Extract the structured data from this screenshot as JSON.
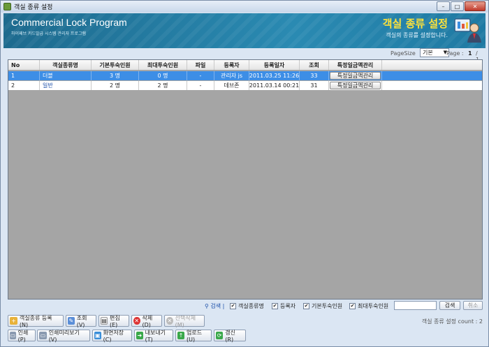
{
  "window": {
    "title": "객실 종류 설정",
    "btn_min": "–",
    "btn_max": "□",
    "btn_close": "✕"
  },
  "banner": {
    "title": "Commercial Lock Program",
    "subtitle": "하이패브 카드발급 시스템 관리자 프로그램",
    "kr_title": "객실 종류 설정",
    "kr_subtitle": "객실의 종류를 설정합니다."
  },
  "paging": {
    "pagesize_label": "PageSize",
    "pagesize_value": "기본",
    "page_label": "Page :",
    "page_current": "1",
    "page_total": "/ 1"
  },
  "table": {
    "columns": [
      "No",
      "객실종류명",
      "기본투숙인원",
      "최대투숙인원",
      "파일",
      "등록자",
      "등록일자",
      "조회",
      "특정일금액관리"
    ],
    "rows": [
      {
        "no": "1",
        "name": "더블",
        "base": "3 명",
        "max": "0 명",
        "file": "-",
        "reg": "관리자 js",
        "date": "2011.03.25 11:26",
        "views": "33",
        "btn": "특정일금액관리",
        "selected": true
      },
      {
        "no": "2",
        "name": "일반",
        "base": "2 명",
        "max": "2 명",
        "file": "-",
        "reg": "데브존",
        "date": "2011.03.14 00:21",
        "views": "31",
        "btn": "특정일금액관리",
        "selected": false
      }
    ]
  },
  "filter": {
    "search_label": "검색 |",
    "checks": [
      "객실종류명",
      "등록자",
      "기본투숙인원",
      "최대투숙인원"
    ],
    "search_btn": "검색",
    "cancel_btn": "취소"
  },
  "actions": {
    "add": "객실종류 등록(N)",
    "view": "조회(V)",
    "edit": "편집(E)",
    "delete": "삭제(D)",
    "delete_sel": "선택삭제(M)",
    "count": "객실 종류 설정 count : 2"
  },
  "bottom": {
    "print": "인쇄(P)",
    "preview": "인쇄미리보기(V)",
    "save_screen": "화면저장(C)",
    "export": "내보내기(T)",
    "upload": "업로드(U)",
    "refresh": "갱신(R)"
  }
}
